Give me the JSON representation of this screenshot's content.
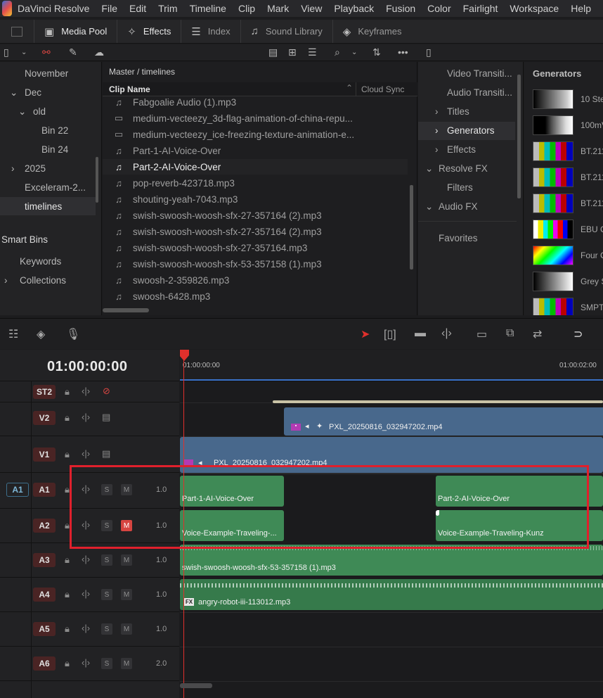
{
  "menubar": {
    "app": "DaVinci Resolve",
    "items": [
      "File",
      "Edit",
      "Trim",
      "Timeline",
      "Clip",
      "Mark",
      "View",
      "Playback",
      "Fusion",
      "Color",
      "Fairlight",
      "Workspace",
      "Help"
    ]
  },
  "toolbar": {
    "media_pool": "Media Pool",
    "effects": "Effects",
    "index": "Index",
    "sound_library": "Sound Library",
    "keyframes": "Keyframes"
  },
  "bins": {
    "items": [
      "November",
      "Dec",
      "old",
      "Bin 22",
      "Bin 24",
      "2025",
      "Exceleram-2...",
      "timelines"
    ],
    "smart_bins": "Smart Bins",
    "smart_items": [
      "Keywords",
      "Collections"
    ]
  },
  "clips": {
    "path": "Master / timelines",
    "col_name": "Clip Name",
    "col_cloud": "Cloud Sync",
    "items": [
      "Fabgoalie Audio (1).mp3",
      "medium-vecteezy_3d-flag-animation-of-china-repu...",
      "medium-vecteezy_ice-freezing-texture-animation-e...",
      "Part-1-AI-Voice-Over",
      "Part-2-AI-Voice-Over",
      "pop-reverb-423718.mp3",
      "shouting-yeah-7043.mp3",
      "swish-swoosh-woosh-sfx-27-357164 (2).mp3",
      "swish-swoosh-woosh-sfx-27-357164 (2).mp3",
      "swish-swoosh-woosh-sfx-27-357164.mp3",
      "swish-swoosh-woosh-sfx-53-357158 (1).mp3",
      "swoosh-2-359826.mp3",
      "swoosh-6428.mp3"
    ]
  },
  "fxtree": {
    "items": [
      "Video Transiti...",
      "Audio Transiti...",
      "Titles",
      "Generators",
      "Effects",
      "Resolve FX",
      "Filters",
      "Audio FX",
      "Favorites"
    ]
  },
  "generators": {
    "title": "Generators",
    "items": [
      "10 Ste",
      "100mV",
      "BT.211",
      "BT.211",
      "BT.211",
      "EBU C",
      "Four C",
      "Grey S",
      "SMPTE"
    ]
  },
  "timeline": {
    "timecode": "01:00:00:00",
    "ruler_start": "01:00:00:00",
    "ruler_end": "01:00:02:00",
    "tracks": {
      "st2": "ST2",
      "v2": "V2",
      "v1": "V1",
      "a1": "A1",
      "a2": "A2",
      "a3": "A3",
      "a4": "A4",
      "a5": "A5",
      "a6": "A6"
    },
    "a1_dest": "A1",
    "s": "S",
    "m": "M",
    "volumes": [
      "1.0",
      "1.0",
      "1.0",
      "1.0",
      "1.0",
      "2.0"
    ],
    "clips": {
      "v2": "PXL_20250816_032947202.mp4",
      "v1": "PXL_20250816_032947202.mp4",
      "a1_left": "Part-1-AI-Voice-Over",
      "a1_right": "Part-2-AI-Voice-Over",
      "a2_left": "Voice-Example-Traveling-...",
      "a2_right": "Voice-Example-Traveling-Kunz",
      "a3": "swish-swoosh-woosh-sfx-53-357158 (1).mp3",
      "a4": "angry-robot-iii-113012.mp3"
    },
    "fx_badge": "FX"
  },
  "colors": {
    "highlight_box": "#e0202c",
    "playhead": "#e0302c",
    "audio_clip": "#3f8a56",
    "video_clip": "#48688c",
    "mute_on": "#d64541"
  }
}
